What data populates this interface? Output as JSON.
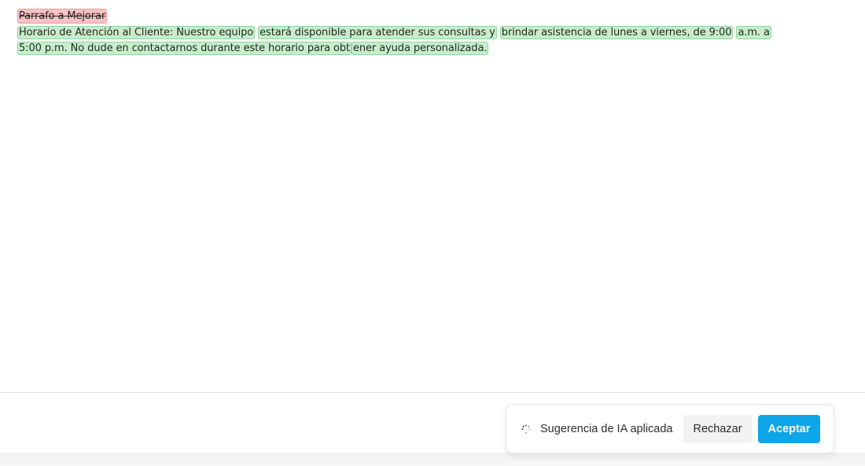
{
  "document": {
    "deleted_heading": "Parrafo a Mejorar",
    "inserted_segments": [
      "Horario de Atención al Cliente: Nuestro equipo",
      "estará disponible para atender sus consultas y",
      "brindar asistencia de lunes a viernes, de 9:00",
      "a.m. a 5:00 p.m. No dude en contactarnos durante este horario para obt",
      "ener ayuda personalizada."
    ]
  },
  "ai_suggestion": {
    "icon": "spinner-icon",
    "status_text": "Sugerencia de IA aplicada",
    "reject_label": "Rechazar",
    "accept_label": "Aceptar"
  },
  "colors": {
    "deleted_bg": "#f7c2c2",
    "inserted_bg": "#c6eecb",
    "accent": "#0ea5e9"
  }
}
